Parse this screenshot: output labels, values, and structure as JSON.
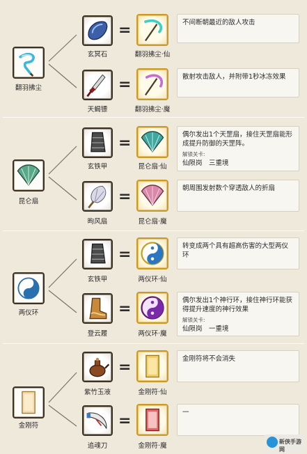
{
  "groups": [
    {
      "base": {
        "label": "翻羽拂尘",
        "icon": "blue-whisk-icon"
      },
      "rows": [
        {
          "material": {
            "label": "玄冥石",
            "icon": "blue-stone-icon"
          },
          "result": {
            "label": "翻羽拂尘·仙",
            "icon": "cyan-whisk-icon"
          },
          "desc": "不间断朝最近的敌人攻击",
          "desc_sub": []
        },
        {
          "material": {
            "label": "天蝎镖",
            "icon": "scorpion-dart-icon"
          },
          "result": {
            "label": "翻羽拂尘·魔",
            "icon": "purple-whisk-icon"
          },
          "desc": "散射攻击敌人，并附带1秒冰冻效果",
          "desc_sub": []
        }
      ]
    },
    {
      "base": {
        "label": "昆仑扇",
        "icon": "jade-fan-icon"
      },
      "rows": [
        {
          "material": {
            "label": "玄铁甲",
            "icon": "iron-bracer-icon"
          },
          "result": {
            "label": "昆仑扇·仙",
            "icon": "teal-fan-icon"
          },
          "desc": "偶尔发出1个天罡扇，接住天罡扇能形成提升防御的天罡阵。",
          "desc_sub": [
            "解锁关卡:",
            "仙陨岗　三重境"
          ]
        },
        {
          "material": {
            "label": "昫风扇",
            "icon": "feather-fan-icon"
          },
          "result": {
            "label": "昆仑扇·魔",
            "icon": "pink-fan-icon"
          },
          "desc": "朝周围发射数个穿透敌人的折扇",
          "desc_sub": []
        }
      ]
    },
    {
      "base": {
        "label": "两仪环",
        "icon": "yinyang-blue-icon"
      },
      "rows": [
        {
          "material": {
            "label": "玄铁甲",
            "icon": "iron-bracer-icon"
          },
          "result": {
            "label": "两仪环·仙",
            "icon": "yinyang-gold-icon"
          },
          "desc": "转变成两个具有超高伤害的大型两仪环",
          "desc_sub": []
        },
        {
          "material": {
            "label": "登云履",
            "icon": "cloud-boots-icon"
          },
          "result": {
            "label": "两仪环·魔",
            "icon": "yinyang-purple-icon"
          },
          "desc": "偶尔发出1个神行环，接住神行环能获得提升速度的神行效果",
          "desc_sub": [
            "解锁关卡:",
            "仙陨岗　一重境"
          ]
        }
      ]
    },
    {
      "base": {
        "label": "金刚符",
        "icon": "talisman-icon"
      },
      "rows": [
        {
          "material": {
            "label": "紫竹玉液",
            "icon": "teapot-icon"
          },
          "result": {
            "label": "金刚符·仙",
            "icon": "gold-talisman-icon"
          },
          "desc": "金刚符将不会消失",
          "desc_sub": []
        },
        {
          "material": {
            "label": "追魂刀",
            "icon": "curved-blade-icon"
          },
          "result": {
            "label": "金刚符·魔",
            "icon": "red-talisman-icon"
          },
          "desc": "一",
          "desc_sub": []
        }
      ]
    }
  ],
  "equals_sign": "=",
  "watermark": {
    "text": "新侠手游网",
    "brand_color": "#1d8fd8"
  }
}
